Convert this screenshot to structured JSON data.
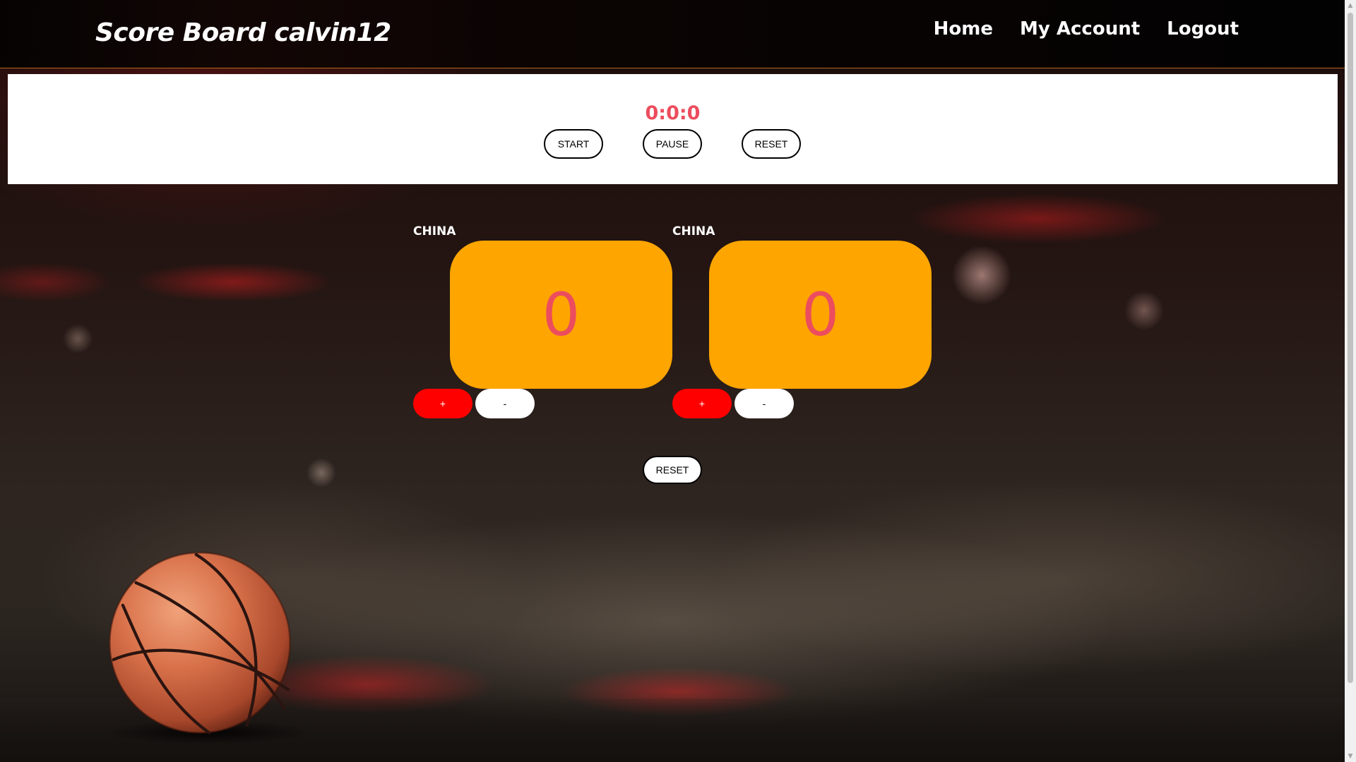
{
  "header": {
    "title": "Score Board calvin12",
    "nav": [
      "Home",
      "My Account",
      "Logout"
    ]
  },
  "timer": {
    "display": "0:0:0",
    "buttons": {
      "start": "START",
      "pause": "PAUSE",
      "reset": "RESET"
    }
  },
  "teams": [
    {
      "name": "CHINA",
      "score": "0",
      "plus": "+",
      "minus": "-"
    },
    {
      "name": "CHINA",
      "score": "0",
      "plus": "+",
      "minus": "-"
    }
  ],
  "reset_scores": "RESET",
  "colors": {
    "header_border": "#b5651d",
    "timer_text": "#ec4d5e",
    "score_box": "#ffa500",
    "score_text": "#ec4d5e",
    "plus_button": "#ff0000",
    "minus_button": "#ffffff"
  },
  "icons": {
    "decoration": "basketball-icon",
    "scroll_up": "scroll-up-arrow-icon",
    "scroll_down": "scroll-down-arrow-icon"
  }
}
